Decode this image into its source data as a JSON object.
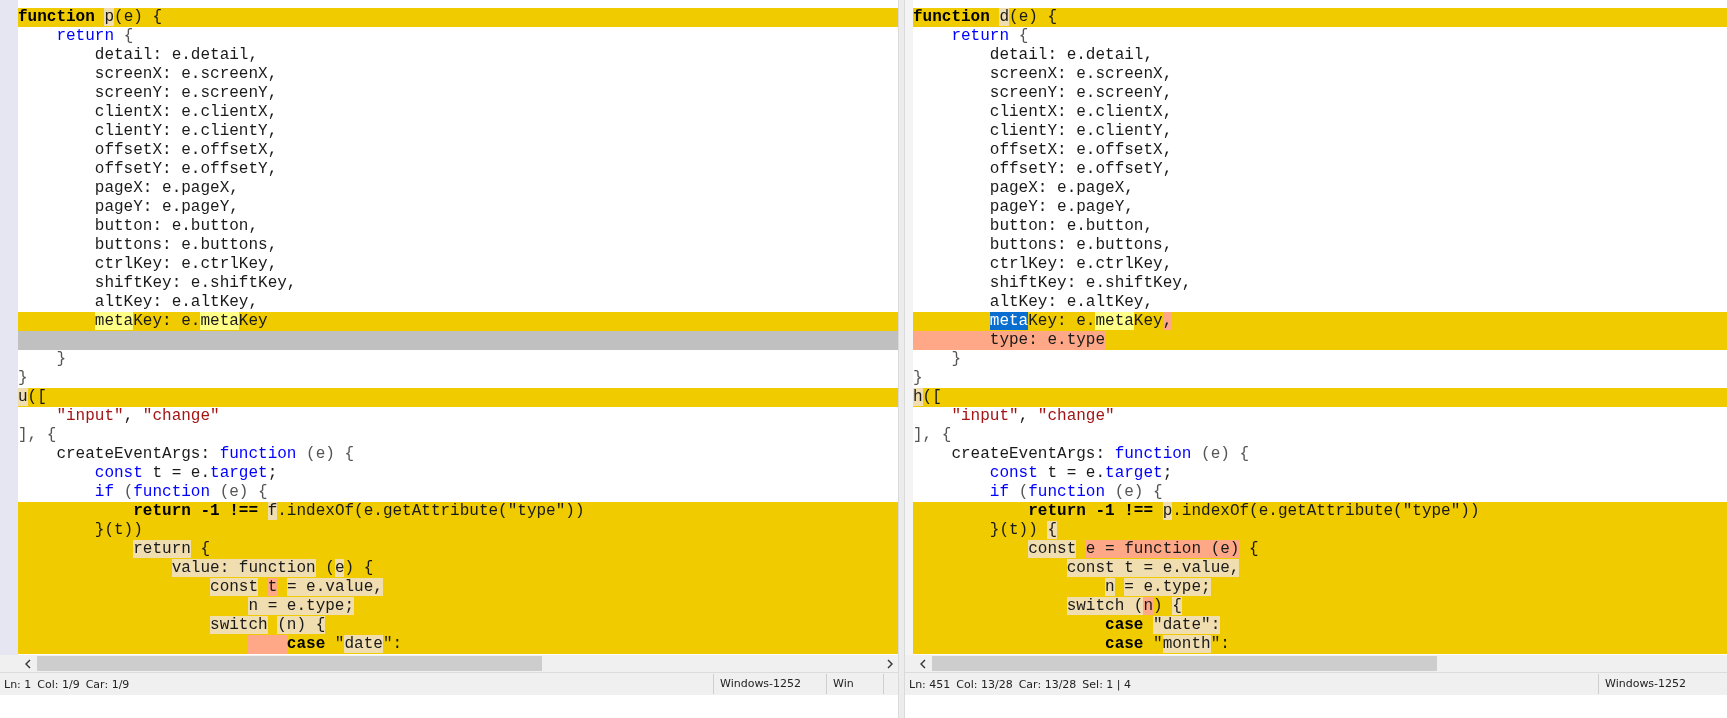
{
  "panes": [
    {
      "lines": [
        {
          "kind": "changed",
          "segments": [
            {
              "text": "function",
              "kind": "keyword"
            },
            {
              "text": " p",
              "changed": true
            },
            {
              "text": "(e) {"
            }
          ]
        },
        {
          "kind": "same",
          "segments": [
            {
              "text": "    return",
              "kind": "keyword"
            },
            {
              "text": " {",
              "kind": "punctuation"
            }
          ]
        },
        {
          "kind": "same",
          "segments": [
            {
              "text": "        detail: e.detail,"
            }
          ]
        },
        {
          "kind": "same",
          "segments": [
            {
              "text": "        screenX: e.screenX,"
            }
          ]
        },
        {
          "kind": "same",
          "segments": [
            {
              "text": "        screenY: e.screenY,"
            }
          ]
        },
        {
          "kind": "same",
          "segments": [
            {
              "text": "        clientX: e.clientX,"
            }
          ]
        },
        {
          "kind": "same",
          "segments": [
            {
              "text": "        clientY: e.clientY,"
            }
          ]
        },
        {
          "kind": "same",
          "segments": [
            {
              "text": "        offsetX: e.offsetX,"
            }
          ]
        },
        {
          "kind": "same",
          "segments": [
            {
              "text": "        offsetY: e.offsetY,"
            }
          ]
        },
        {
          "kind": "same",
          "segments": [
            {
              "text": "        pageX: e.pageX,"
            }
          ]
        },
        {
          "kind": "same",
          "segments": [
            {
              "text": "        pageY: e.pageY,"
            }
          ]
        },
        {
          "kind": "same",
          "segments": [
            {
              "text": "        button: e.button,"
            }
          ]
        },
        {
          "kind": "same",
          "segments": [
            {
              "text": "        buttons: e.buttons,"
            }
          ]
        },
        {
          "kind": "same",
          "segments": [
            {
              "text": "        ctrlKey: e.ctrlKey,"
            }
          ]
        },
        {
          "kind": "same",
          "segments": [
            {
              "text": "        shiftKey: e.shiftKey,"
            }
          ]
        },
        {
          "kind": "same",
          "segments": [
            {
              "text": "        altKey: e.altKey,"
            }
          ]
        },
        {
          "kind": "changed",
          "segments": [
            {
              "text": "        meta",
              "matched": true
            },
            {
              "text": "Key: e."
            },
            {
              "text": "meta",
              "matched": true
            },
            {
              "text": "Key"
            }
          ]
        },
        {
          "kind": "filler"
        },
        {
          "kind": "same",
          "segments": [
            {
              "text": "    }",
              "kind": "punctuation"
            }
          ]
        },
        {
          "kind": "same",
          "segments": [
            {
              "text": "}",
              "kind": "punctuation"
            }
          ]
        },
        {
          "kind": "changed",
          "segments": [
            {
              "text": "u",
              "changed": true
            },
            {
              "text": "(["
            }
          ]
        },
        {
          "kind": "same",
          "segments": [
            {
              "text": "    \"input\"",
              "kind": "string"
            },
            {
              "text": ", "
            },
            {
              "text": "\"change\"",
              "kind": "string"
            }
          ]
        },
        {
          "kind": "same",
          "segments": [
            {
              "text": "], {",
              "kind": "punctuation"
            }
          ]
        },
        {
          "kind": "same",
          "segments": [
            {
              "text": "    createEventArgs: "
            },
            {
              "text": "function",
              "kind": "keyword"
            },
            {
              "text": " (e) {",
              "kind": "punctuation"
            }
          ]
        },
        {
          "kind": "same",
          "segments": [
            {
              "text": "        const",
              "kind": "keyword"
            },
            {
              "text": " t = e."
            },
            {
              "text": "target",
              "kind": "keyword"
            },
            {
              "text": ";"
            }
          ]
        },
        {
          "kind": "same",
          "segments": [
            {
              "text": "        if",
              "kind": "keyword"
            },
            {
              "text": " (",
              "kind": "punctuation"
            },
            {
              "text": "function",
              "kind": "keyword"
            },
            {
              "text": " (e) {",
              "kind": "punctuation"
            }
          ]
        },
        {
          "kind": "changed",
          "segments": [
            {
              "text": "            return -1 !==",
              "kind": "keyword"
            },
            {
              "text": " f",
              "changed": true
            },
            {
              "text": ".indexOf(e.getAttribute(\"type\"))"
            }
          ]
        },
        {
          "kind": "changed",
          "segments": [
            {
              "text": "        }(t))"
            }
          ]
        },
        {
          "kind": "changed",
          "segments": [
            {
              "text": "            return",
              "changed": true
            },
            {
              "text": " {"
            }
          ]
        },
        {
          "kind": "changed",
          "segments": [
            {
              "text": "                value: function",
              "changed": true
            },
            {
              "text": " ("
            },
            {
              "text": "e",
              "changed": true
            },
            {
              "text": ") {"
            }
          ]
        },
        {
          "kind": "changed",
          "segments": [
            {
              "text": "                    const",
              "changed": true
            },
            {
              "text": " t",
              "inserted": true
            },
            {
              "text": " = e.value,",
              "changed": true
            }
          ]
        },
        {
          "kind": "changed",
          "segments": [
            {
              "text": "                        n = e.type;",
              "changed": true
            }
          ]
        },
        {
          "kind": "changed",
          "segments": [
            {
              "text": "                    switch",
              "changed": true
            },
            {
              "text": " (n) {",
              "changed": true
            }
          ]
        },
        {
          "kind": "changed",
          "segments": [
            {
              "text": "                        case",
              "kind": "keyword",
              "gap_inserted": true
            },
            {
              "text": " \""
            },
            {
              "text": "date",
              "changed": true
            },
            {
              "text": "\":"
            }
          ]
        }
      ],
      "status": {
        "fields": [
          "Ln: 1",
          "Col: 1/9",
          "Car: 1/9"
        ],
        "encoding": "Windows-1252",
        "line_endings": "Win"
      }
    },
    {
      "lines": [
        {
          "kind": "changed",
          "segments": [
            {
              "text": "function",
              "kind": "keyword"
            },
            {
              "text": " d",
              "changed": true
            },
            {
              "text": "(e) {"
            }
          ]
        },
        {
          "kind": "same",
          "segments": [
            {
              "text": "    return",
              "kind": "keyword"
            },
            {
              "text": " {",
              "kind": "punctuation"
            }
          ]
        },
        {
          "kind": "same",
          "segments": [
            {
              "text": "        detail: e.detail,"
            }
          ]
        },
        {
          "kind": "same",
          "segments": [
            {
              "text": "        screenX: e.screenX,"
            }
          ]
        },
        {
          "kind": "same",
          "segments": [
            {
              "text": "        screenY: e.screenY,"
            }
          ]
        },
        {
          "kind": "same",
          "segments": [
            {
              "text": "        clientX: e.clientX,"
            }
          ]
        },
        {
          "kind": "same",
          "segments": [
            {
              "text": "        clientY: e.clientY,"
            }
          ]
        },
        {
          "kind": "same",
          "segments": [
            {
              "text": "        offsetX: e.offsetX,"
            }
          ]
        },
        {
          "kind": "same",
          "segments": [
            {
              "text": "        offsetY: e.offsetY,"
            }
          ]
        },
        {
          "kind": "same",
          "segments": [
            {
              "text": "        pageX: e.pageX,"
            }
          ]
        },
        {
          "kind": "same",
          "segments": [
            {
              "text": "        pageY: e.pageY,"
            }
          ]
        },
        {
          "kind": "same",
          "segments": [
            {
              "text": "        button: e.button,"
            }
          ]
        },
        {
          "kind": "same",
          "segments": [
            {
              "text": "        buttons: e.buttons,"
            }
          ]
        },
        {
          "kind": "same",
          "segments": [
            {
              "text": "        ctrlKey: e.ctrlKey,"
            }
          ]
        },
        {
          "kind": "same",
          "segments": [
            {
              "text": "        shiftKey: e.shiftKey,"
            }
          ]
        },
        {
          "kind": "same",
          "segments": [
            {
              "text": "        altKey: e.altKey,"
            }
          ]
        },
        {
          "kind": "changed",
          "segments": [
            {
              "text": "        meta",
              "selected": true
            },
            {
              "text": "Key: e."
            },
            {
              "text": "meta",
              "matched": true
            },
            {
              "text": "Key"
            },
            {
              "text": ",",
              "inserted": true
            }
          ]
        },
        {
          "kind": "added",
          "segments": [
            {
              "text": "        type: e.type"
            }
          ]
        },
        {
          "kind": "same",
          "segments": [
            {
              "text": "    }",
              "kind": "punctuation"
            }
          ]
        },
        {
          "kind": "same",
          "segments": [
            {
              "text": "}",
              "kind": "punctuation"
            }
          ]
        },
        {
          "kind": "changed",
          "segments": [
            {
              "text": "h",
              "changed": true
            },
            {
              "text": "(["
            }
          ]
        },
        {
          "kind": "same",
          "segments": [
            {
              "text": "    \"input\"",
              "kind": "string"
            },
            {
              "text": ", "
            },
            {
              "text": "\"change\"",
              "kind": "string"
            }
          ]
        },
        {
          "kind": "same",
          "segments": [
            {
              "text": "], {",
              "kind": "punctuation"
            }
          ]
        },
        {
          "kind": "same",
          "segments": [
            {
              "text": "    createEventArgs: "
            },
            {
              "text": "function",
              "kind": "keyword"
            },
            {
              "text": " (e) {",
              "kind": "punctuation"
            }
          ]
        },
        {
          "kind": "same",
          "segments": [
            {
              "text": "        const",
              "kind": "keyword"
            },
            {
              "text": " t = e."
            },
            {
              "text": "target",
              "kind": "keyword"
            },
            {
              "text": ";"
            }
          ]
        },
        {
          "kind": "same",
          "segments": [
            {
              "text": "        if",
              "kind": "keyword"
            },
            {
              "text": " (",
              "kind": "punctuation"
            },
            {
              "text": "function",
              "kind": "keyword"
            },
            {
              "text": " (e) {",
              "kind": "punctuation"
            }
          ]
        },
        {
          "kind": "changed",
          "segments": [
            {
              "text": "            return -1 !==",
              "kind": "keyword"
            },
            {
              "text": " p",
              "changed": true
            },
            {
              "text": ".indexOf(e.getAttribute(\"type\"))"
            }
          ]
        },
        {
          "kind": "changed",
          "segments": [
            {
              "text": "        }(t))"
            },
            {
              "text": " {",
              "changed": true
            }
          ]
        },
        {
          "kind": "changed",
          "segments": [
            {
              "text": "            const",
              "changed": true
            },
            {
              "text": " e = function (e)",
              "inserted": true
            },
            {
              "text": " {"
            }
          ]
        },
        {
          "kind": "changed",
          "segments": [
            {
              "text": "                const t = e.value,",
              "changed": true
            }
          ]
        },
        {
          "kind": "changed",
          "segments": [
            {
              "text": "                    n",
              "changed": true
            },
            {
              "text": " = e.type;",
              "changed": true
            }
          ]
        },
        {
          "kind": "changed",
          "segments": [
            {
              "text": "                switch (",
              "changed": true
            },
            {
              "text": "n",
              "inserted": true
            },
            {
              "text": ")"
            },
            {
              "text": " {",
              "changed": true
            }
          ]
        },
        {
          "kind": "changed",
          "segments": [
            {
              "text": "                    case",
              "kind": "keyword"
            },
            {
              "text": " \"date\":",
              "changed": true
            }
          ]
        },
        {
          "kind": "changed",
          "segments": [
            {
              "text": "                    case",
              "kind": "keyword"
            },
            {
              "text": " \""
            },
            {
              "text": "month",
              "changed": true
            },
            {
              "text": "\":"
            }
          ]
        }
      ],
      "status": {
        "fields": [
          "Ln: 451",
          "Col: 13/28",
          "Car: 13/28",
          "Sel: 1 | 4"
        ],
        "encoding": "Windows-1252"
      }
    }
  ]
}
